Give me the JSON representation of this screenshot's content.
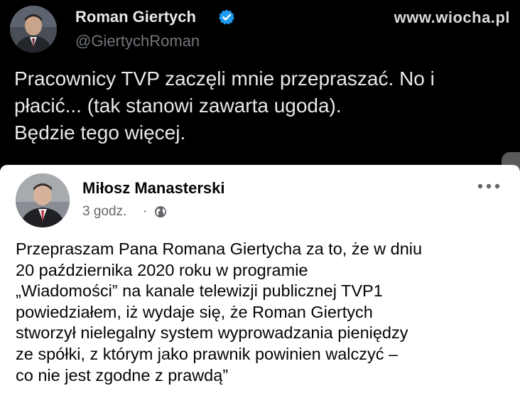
{
  "watermark": "www.wiocha.pl",
  "tweet": {
    "author_name": "Roman Giertych",
    "handle": "@GiertychRoman",
    "text_lines": [
      "Pracownicy TVP zaczęli mnie przepraszać. No i",
      "płacić... (tak stanowi zawarta ugoda).",
      "Będzie tego więcej."
    ],
    "verified_color": "#1d9bf0"
  },
  "facebook_post": {
    "author_name": "Miłosz Manasterski",
    "time": "3 godz.",
    "separator": "·",
    "privacy_icon": "globe-icon",
    "text_lines": [
      "Przepraszam Pana Romana Giertycha za to, że w dniu",
      "20 października 2020 roku w programie",
      "„Wiadomości” na kanale telewizji publicznej TVP1",
      "powiedziałem, iż wydaje się, że Roman Giertych",
      "stworzył nielegalny system wyprowadzania pieniędzy",
      "ze spółki, z którym jako prawnik powinien walczyć –",
      "co nie jest zgodne z prawdą”"
    ]
  }
}
